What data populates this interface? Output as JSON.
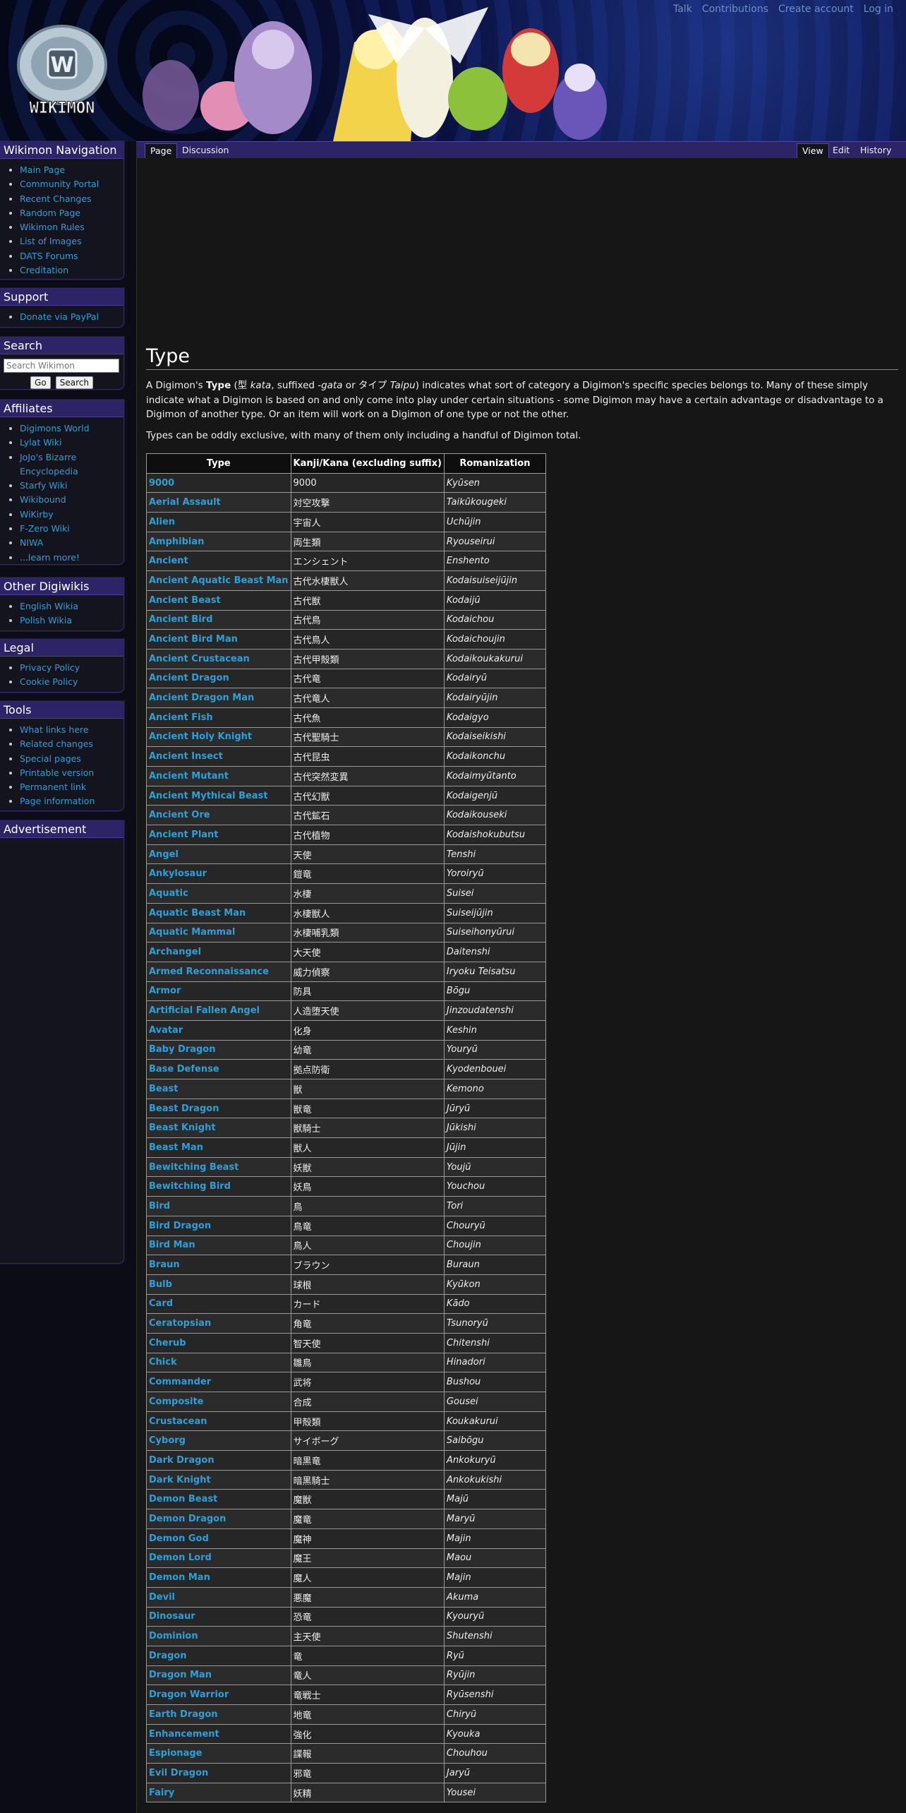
{
  "personal_links": [
    "Talk",
    "Contributions",
    "Create account",
    "Log in"
  ],
  "logo_text": "WIKIMON",
  "sidebar": {
    "navigation": {
      "title": "Wikimon Navigation",
      "items": [
        "Main Page",
        "Community Portal",
        "Recent Changes",
        "Random Page",
        "Wikimon Rules",
        "List of Images",
        "DATS Forums",
        "Creditation"
      ]
    },
    "support": {
      "title": "Support",
      "items": [
        "Donate via PayPal"
      ]
    },
    "search": {
      "title": "Search",
      "placeholder": "Search Wikimon",
      "go_label": "Go",
      "search_label": "Search"
    },
    "affiliates": {
      "title": "Affiliates",
      "items": [
        "Digimons World",
        "Lylat Wiki",
        "JoJo's Bizarre Encyclopedia",
        "Starfy Wiki",
        "Wikibound",
        "WiKirby",
        "F-Zero Wiki",
        "NIWA",
        "...learn more!"
      ]
    },
    "other_digiwikis": {
      "title": "Other Digiwikis",
      "items": [
        "English Wikia",
        "Polish Wikia"
      ]
    },
    "legal": {
      "title": "Legal",
      "items": [
        "Privacy Policy",
        "Cookie Policy"
      ]
    },
    "tools": {
      "title": "Tools",
      "items": [
        "What links here",
        "Related changes",
        "Special pages",
        "Printable version",
        "Permanent link",
        "Page information"
      ]
    },
    "advertisement": {
      "title": "Advertisement"
    }
  },
  "tabs": {
    "left": [
      "Page",
      "Discussion"
    ],
    "right": [
      "View",
      "Edit",
      "History"
    ]
  },
  "page": {
    "title": "Type",
    "intro_parts": {
      "a": "A Digimon's ",
      "b": "Type",
      "c": " (型 ",
      "d": "kata",
      "e": ", suffixed ",
      "f": "-gata",
      "g": " or タイプ ",
      "h": "Taipu",
      "i": ") indicates what sort of category a Digimon's specific species belongs to. Many of these simply indicate what a Digimon is based on and only come into play under certain situations - some Digimon may have a certain advantage or disadvantage to a Digimon of another type. Or an item will work on a Digimon of one type or not the other."
    },
    "para2": "Types can be oddly exclusive, with many of them only including a handful of Digimon total."
  },
  "table": {
    "headers": [
      "Type",
      "Kanji/Kana (excluding suffix)",
      "Romanization"
    ],
    "rows": [
      [
        "9000",
        "9000",
        "Kyūsen"
      ],
      [
        "Aerial Assault",
        "対空攻撃",
        "Taikūkougeki"
      ],
      [
        "Alien",
        "宇宙人",
        "Uchūjin"
      ],
      [
        "Amphibian",
        "両生類",
        "Ryouseirui"
      ],
      [
        "Ancient",
        "エンシェント",
        "Enshento"
      ],
      [
        "Ancient Aquatic Beast Man",
        "古代水棲獣人",
        "Kodaisuiseijūjin"
      ],
      [
        "Ancient Beast",
        "古代獣",
        "Kodaijū"
      ],
      [
        "Ancient Bird",
        "古代鳥",
        "Kodaichou"
      ],
      [
        "Ancient Bird Man",
        "古代鳥人",
        "Kodaichoujin"
      ],
      [
        "Ancient Crustacean",
        "古代甲殻類",
        "Kodaikoukakurui"
      ],
      [
        "Ancient Dragon",
        "古代竜",
        "Kodairyū"
      ],
      [
        "Ancient Dragon Man",
        "古代竜人",
        "Kodairyūjin"
      ],
      [
        "Ancient Fish",
        "古代魚",
        "Kodaigyo"
      ],
      [
        "Ancient Holy Knight",
        "古代聖騎士",
        "Kodaiseikishi"
      ],
      [
        "Ancient Insect",
        "古代昆虫",
        "Kodaikonchu"
      ],
      [
        "Ancient Mutant",
        "古代突然変異",
        "Kodaimyūtanto"
      ],
      [
        "Ancient Mythical Beast",
        "古代幻獣",
        "Kodaigenjū"
      ],
      [
        "Ancient Ore",
        "古代鉱石",
        "Kodaikouseki"
      ],
      [
        "Ancient Plant",
        "古代植物",
        "Kodaishokubutsu"
      ],
      [
        "Angel",
        "天使",
        "Tenshi"
      ],
      [
        "Ankylosaur",
        "鎧竜",
        "Yoroiryū"
      ],
      [
        "Aquatic",
        "水棲",
        "Suisei"
      ],
      [
        "Aquatic Beast Man",
        "水棲獣人",
        "Suiseijūjin"
      ],
      [
        "Aquatic Mammal",
        "水棲哺乳類",
        "Suiseihonyūrui"
      ],
      [
        "Archangel",
        "大天使",
        "Daitenshi"
      ],
      [
        "Armed Reconnaissance",
        "威力偵察",
        "Iryoku Teisatsu"
      ],
      [
        "Armor",
        "防具",
        "Bōgu"
      ],
      [
        "Artificial Fallen Angel",
        "人造堕天使",
        "Jinzoudatenshi"
      ],
      [
        "Avatar",
        "化身",
        "Keshin"
      ],
      [
        "Baby Dragon",
        "幼竜",
        "Youryū"
      ],
      [
        "Base Defense",
        "拠点防衛",
        "Kyodenbouei"
      ],
      [
        "Beast",
        "獣",
        "Kemono"
      ],
      [
        "Beast Dragon",
        "獣竜",
        "Jūryū"
      ],
      [
        "Beast Knight",
        "獣騎士",
        "Jūkishi"
      ],
      [
        "Beast Man",
        "獣人",
        "Jūjin"
      ],
      [
        "Bewitching Beast",
        "妖獣",
        "Youjū"
      ],
      [
        "Bewitching Bird",
        "妖鳥",
        "Youchou"
      ],
      [
        "Bird",
        "鳥",
        "Tori"
      ],
      [
        "Bird Dragon",
        "鳥竜",
        "Chouryū"
      ],
      [
        "Bird Man",
        "鳥人",
        "Choujin"
      ],
      [
        "Braun",
        "ブラウン",
        "Buraun"
      ],
      [
        "Bulb",
        "球根",
        "Kyūkon"
      ],
      [
        "Card",
        "カード",
        "Kādo"
      ],
      [
        "Ceratopsian",
        "角竜",
        "Tsunoryū"
      ],
      [
        "Cherub",
        "智天使",
        "Chitenshi"
      ],
      [
        "Chick",
        "雛鳥",
        "Hinadori"
      ],
      [
        "Commander",
        "武将",
        "Bushou"
      ],
      [
        "Composite",
        "合成",
        "Gousei"
      ],
      [
        "Crustacean",
        "甲殻類",
        "Koukakurui"
      ],
      [
        "Cyborg",
        "サイボーグ",
        "Saibōgu"
      ],
      [
        "Dark Dragon",
        "暗黒竜",
        "Ankokuryū"
      ],
      [
        "Dark Knight",
        "暗黒騎士",
        "Ankokukishi"
      ],
      [
        "Demon Beast",
        "魔獣",
        "Majū"
      ],
      [
        "Demon Dragon",
        "魔竜",
        "Maryū"
      ],
      [
        "Demon God",
        "魔神",
        "Majin"
      ],
      [
        "Demon Lord",
        "魔王",
        "Maou"
      ],
      [
        "Demon Man",
        "魔人",
        "Majin"
      ],
      [
        "Devil",
        "悪魔",
        "Akuma"
      ],
      [
        "Dinosaur",
        "恐竜",
        "Kyouryū"
      ],
      [
        "Dominion",
        "主天使",
        "Shutenshi"
      ],
      [
        "Dragon",
        "竜",
        "Ryū"
      ],
      [
        "Dragon Man",
        "竜人",
        "Ryūjin"
      ],
      [
        "Dragon Warrior",
        "竜戦士",
        "Ryūsenshi"
      ],
      [
        "Earth Dragon",
        "地竜",
        "Chiryū"
      ],
      [
        "Enhancement",
        "強化",
        "Kyouka"
      ],
      [
        "Espionage",
        "諜報",
        "Chouhou"
      ],
      [
        "Evil Dragon",
        "邪竜",
        "Jaryū"
      ],
      [
        "Fairy",
        "妖精",
        "Yousei"
      ]
    ]
  }
}
